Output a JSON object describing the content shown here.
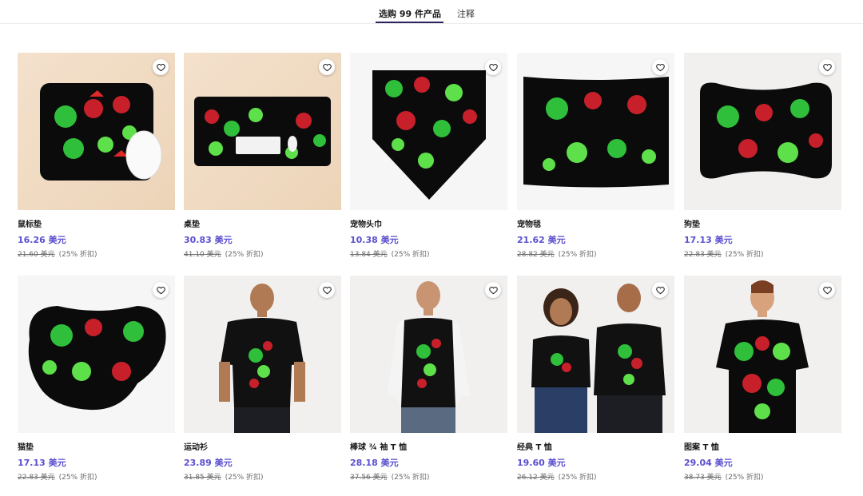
{
  "tabs": [
    {
      "label": "选购 99 件产品"
    },
    {
      "label": "注释"
    }
  ],
  "products": [
    {
      "name": "鼠标垫",
      "price": "16.26 美元",
      "original": "21.60 美元",
      "discount": "(25% 折扣)"
    },
    {
      "name": "桌垫",
      "price": "30.83 美元",
      "original": "41.10 美元",
      "discount": "(25% 折扣)"
    },
    {
      "name": "宠物头巾",
      "price": "10.38 美元",
      "original": "13.84 美元",
      "discount": "(25% 折扣)"
    },
    {
      "name": "宠物毯",
      "price": "21.62 美元",
      "original": "28.82 美元",
      "discount": "(25% 折扣)"
    },
    {
      "name": "狗垫",
      "price": "17.13 美元",
      "original": "22.83 美元",
      "discount": "(25% 折扣)"
    },
    {
      "name": "猫垫",
      "price": "17.13 美元",
      "original": "22.83 美元",
      "discount": "(25% 折扣)"
    },
    {
      "name": "运动衫",
      "price": "23.89 美元",
      "original": "31.85 美元",
      "discount": "(25% 折扣)"
    },
    {
      "name": "棒球 ¾ 袖 T 恤",
      "price": "28.18 美元",
      "original": "37.56 美元",
      "discount": "(25% 折扣)"
    },
    {
      "name": "经典 T 恤",
      "price": "19.60 美元",
      "original": "26.12 美元",
      "discount": "(25% 折扣)"
    },
    {
      "name": "图案 T 恤",
      "price": "29.04 美元",
      "original": "38.73 美元",
      "discount": "(25% 折扣)"
    }
  ],
  "icons": {
    "favorite": "heart-outline-icon"
  },
  "colors": {
    "price": "#5a4fcf",
    "tab_underline": "#2a2560",
    "artwork_bg": "#0b0b0b",
    "parrot_green": "#2fbf3a",
    "parrot_red": "#c8202a",
    "leaf_green": "#5ee04a"
  }
}
